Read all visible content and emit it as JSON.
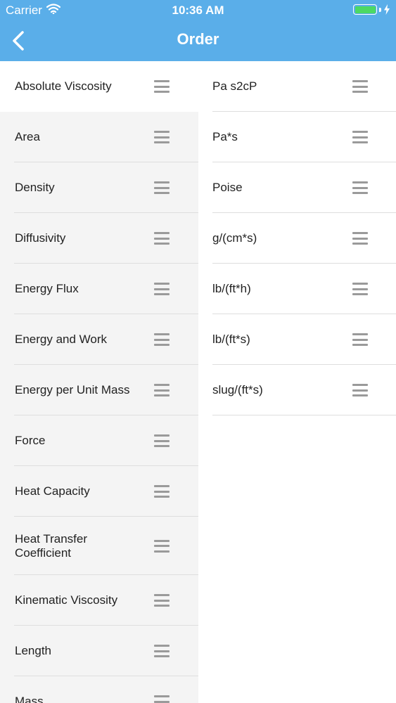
{
  "status_bar": {
    "carrier": "Carrier",
    "time": "10:36 AM"
  },
  "nav": {
    "title": "Order",
    "back_icon": "chevron-left-icon"
  },
  "colors": {
    "header": "#5aaee9",
    "battery": "#4cd964",
    "left_pane": "#f4f4f4",
    "handle": "#9a9a9a"
  },
  "categories": [
    {
      "label": "Absolute Viscosity",
      "selected": true
    },
    {
      "label": "Area"
    },
    {
      "label": "Density"
    },
    {
      "label": "Diffusivity"
    },
    {
      "label": "Energy Flux"
    },
    {
      "label": "Energy and Work"
    },
    {
      "label": "Energy per Unit Mass"
    },
    {
      "label": "Force"
    },
    {
      "label": "Heat Capacity"
    },
    {
      "label": "Heat Transfer Coefficient"
    },
    {
      "label": "Kinematic Viscosity"
    },
    {
      "label": "Length"
    },
    {
      "label": "Mass"
    }
  ],
  "units": [
    {
      "label": "Pa s2cP"
    },
    {
      "label": "Pa*s"
    },
    {
      "label": "Poise"
    },
    {
      "label": "g/(cm*s)"
    },
    {
      "label": "lb/(ft*h)"
    },
    {
      "label": "lb/(ft*s)"
    },
    {
      "label": "slug/(ft*s)"
    }
  ],
  "handle_icon": "drag-handle-icon"
}
